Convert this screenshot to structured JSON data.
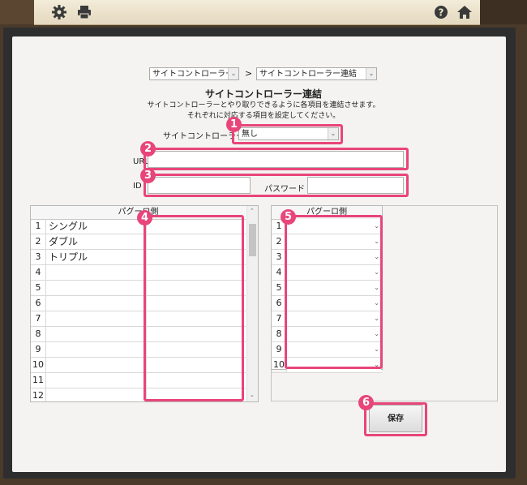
{
  "toolbar": {
    "icons": [
      "gear-icon",
      "print-icon",
      "help-icon",
      "home-icon"
    ]
  },
  "breadcrumb": {
    "first_select": "サイトコントローラー",
    "separator": ">",
    "second_select": "サイトコントローラー連結"
  },
  "header": {
    "title": "サイトコントローラー連結",
    "desc1": "サイトコントローラーとやり取りできるように各項目を連結させます。",
    "desc2": "それぞれに対応する項目を設定してください。"
  },
  "form": {
    "sitecontroller_label": "サイトコントローラー",
    "sitecontroller_value": "無し",
    "url_label": "URL",
    "url_value": "",
    "id_label": "ID",
    "id_value": "",
    "password_label": "パスワード",
    "password_value": ""
  },
  "left_table": {
    "header": "パグーロ側",
    "rows": [
      {
        "num": "1",
        "name": "シングル"
      },
      {
        "num": "2",
        "name": "ダブル"
      },
      {
        "num": "3",
        "name": "トリプル"
      },
      {
        "num": "4",
        "name": ""
      },
      {
        "num": "5",
        "name": ""
      },
      {
        "num": "6",
        "name": ""
      },
      {
        "num": "7",
        "name": ""
      },
      {
        "num": "8",
        "name": ""
      },
      {
        "num": "9",
        "name": ""
      },
      {
        "num": "10",
        "name": ""
      },
      {
        "num": "11",
        "name": ""
      },
      {
        "num": "12",
        "name": ""
      }
    ]
  },
  "right_table": {
    "header": "パグーロ側",
    "rows": [
      "1",
      "2",
      "3",
      "4",
      "5",
      "6",
      "7",
      "8",
      "9",
      "10"
    ]
  },
  "buttons": {
    "save": "保存"
  },
  "badges": [
    "1",
    "2",
    "3",
    "4",
    "5",
    "6"
  ],
  "colors": {
    "highlight": "#e8457a",
    "panel": "#f4f3f1",
    "frame": "#2e2e2e"
  }
}
